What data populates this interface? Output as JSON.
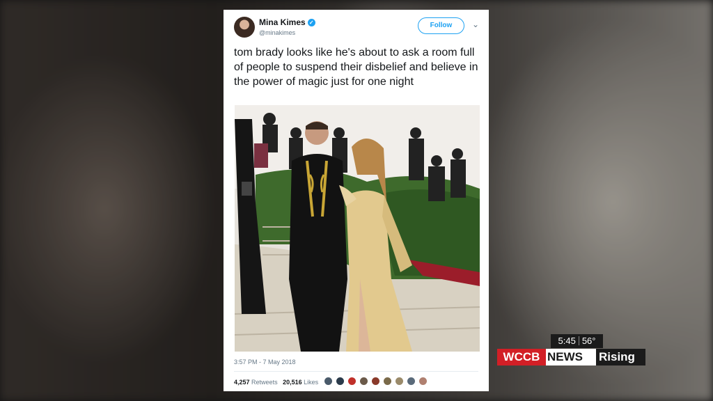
{
  "tweet": {
    "author_name": "Mina Kimes",
    "handle": "@minakimes",
    "follow_label": "Follow",
    "text": "tom brady looks like he's about to ask a room full of people to suspend their disbelief and believe in the power of magic just for one night",
    "timestamp": "3:57 PM - 7 May 2018",
    "retweets_count": "4,257",
    "retweets_label": "Retweets",
    "likes_count": "20,516",
    "likes_label": "Likes"
  },
  "icons": {
    "verified": "verified-badge-icon",
    "more": "chevron-down-icon"
  },
  "broadcast": {
    "time": "5:45",
    "temperature": "56°",
    "brand_wccb": "WCCB",
    "brand_news": "NEWS",
    "brand_rising": "Rising",
    "colors": {
      "brand_red": "#d21f26",
      "dark": "#1b1b1b",
      "twitter_blue": "#1da1f2"
    }
  }
}
